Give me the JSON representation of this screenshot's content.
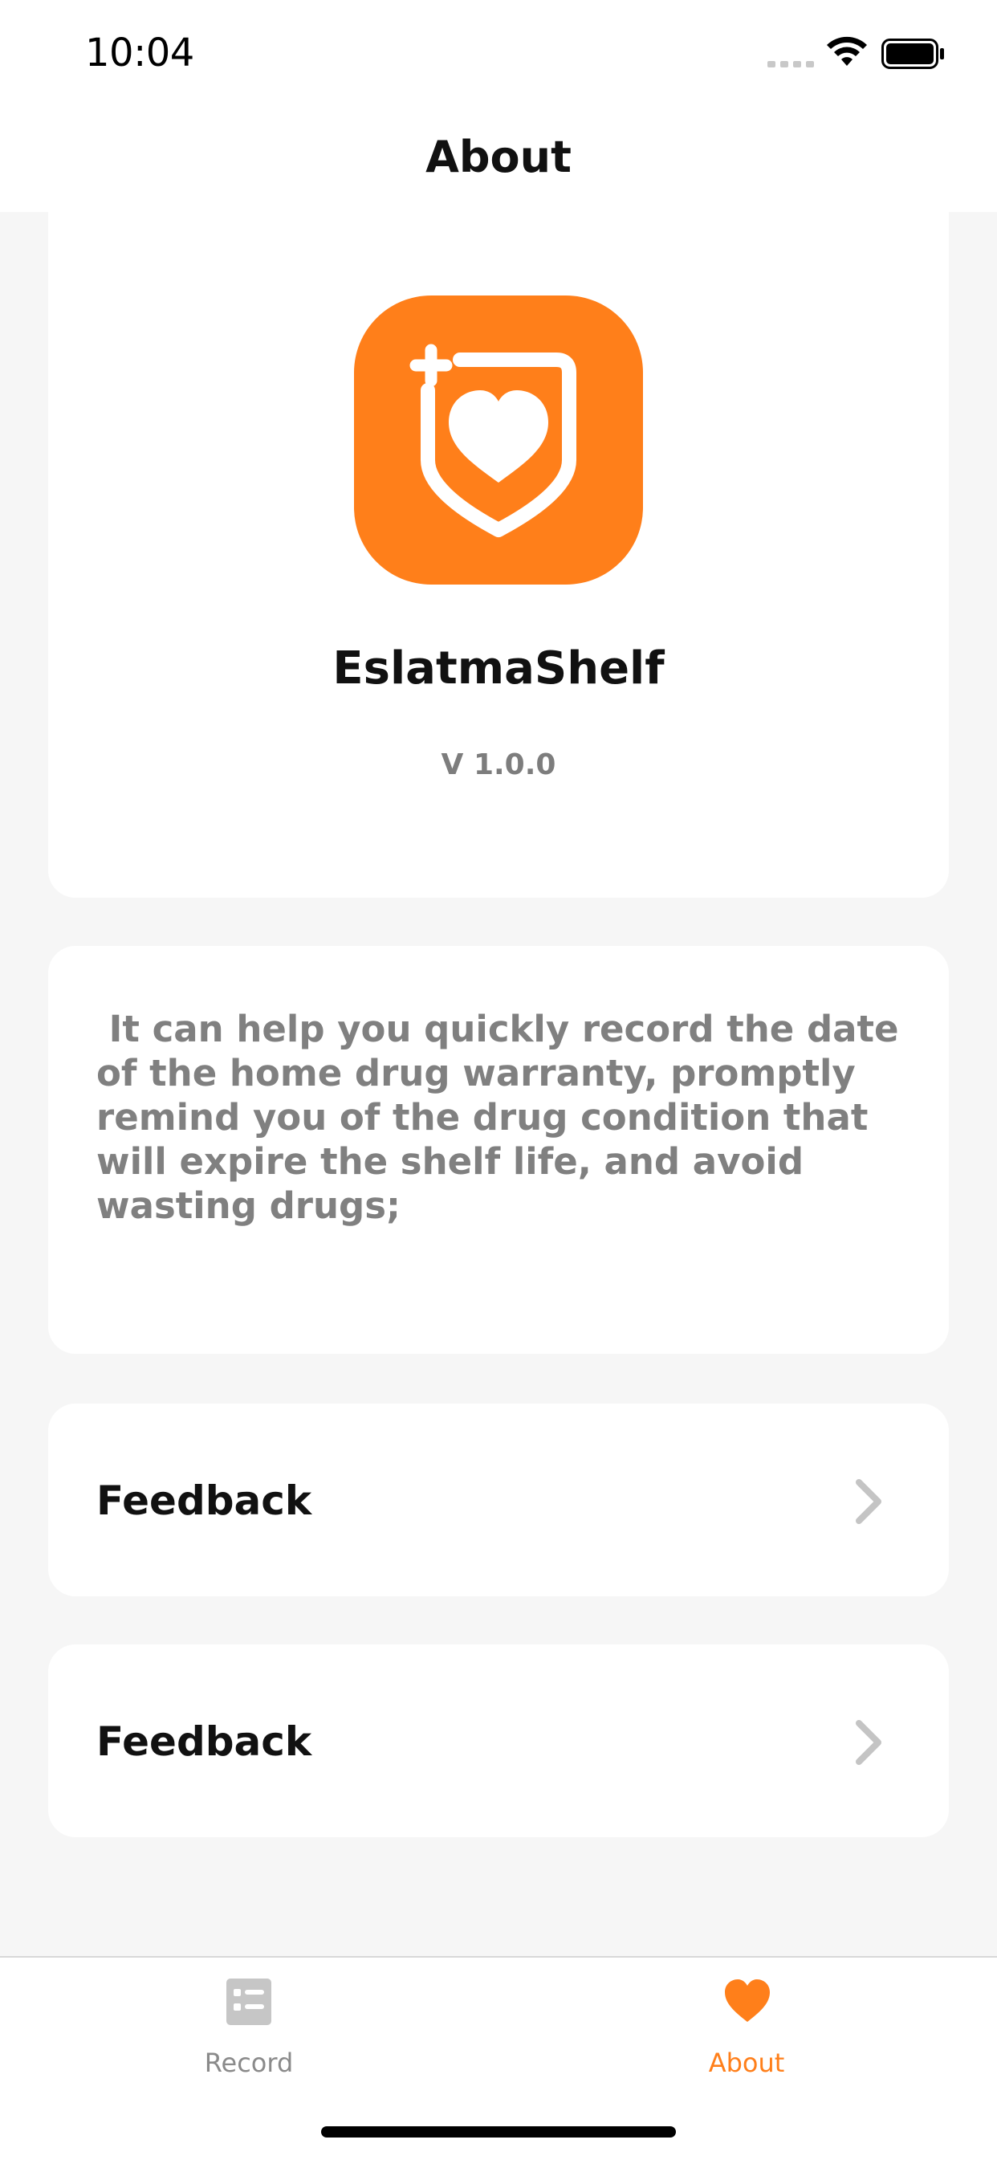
{
  "status_bar": {
    "time": "10:04"
  },
  "nav": {
    "title": "About"
  },
  "header_card": {
    "app_name": "EslatmaShelf",
    "version": "V 1.0.0",
    "icon": "shield-heart-plus-icon",
    "accent_color": "#ff7f1a"
  },
  "description": {
    "text": " It can help you quickly record the date\nof the home drug warranty, promptly\nremind you of the drug condition that\nwill expire the shelf life, and avoid\nwasting drugs;"
  },
  "rows": [
    {
      "label": "Feedback",
      "icon": "chevron-right-icon"
    },
    {
      "label": "Feedback",
      "icon": "chevron-right-icon"
    }
  ],
  "tab_bar": {
    "tabs": [
      {
        "label": "Record",
        "icon": "list-icon",
        "active": false
      },
      {
        "label": "About",
        "icon": "heart-icon",
        "active": true
      }
    ],
    "active_color": "#ff7f1a",
    "inactive_color": "#8a8a8a"
  }
}
